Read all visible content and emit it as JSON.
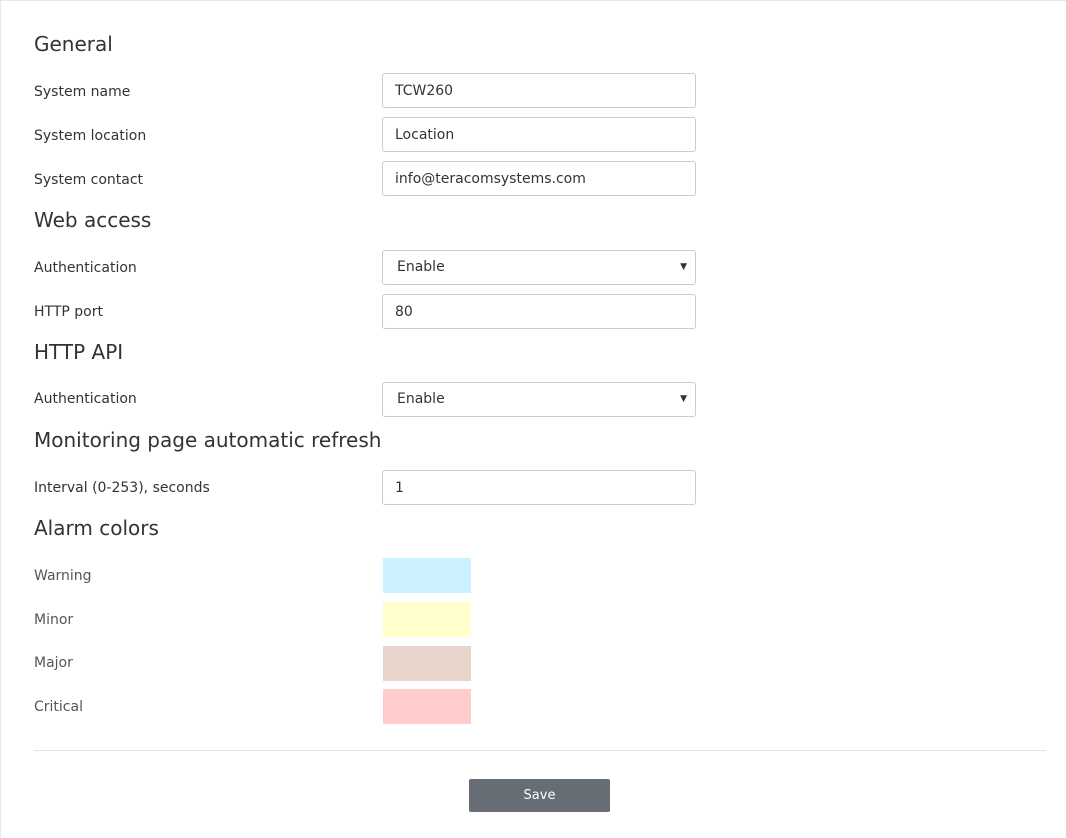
{
  "general": {
    "title": "General",
    "system_name": {
      "label": "System name",
      "value": "TCW260"
    },
    "system_location": {
      "label": "System location",
      "value": "Location"
    },
    "system_contact": {
      "label": "System contact",
      "value": "info@teracomsystems.com"
    }
  },
  "web_access": {
    "title": "Web access",
    "authentication": {
      "label": "Authentication",
      "value": "Enable"
    },
    "http_port": {
      "label": "HTTP port",
      "value": "80"
    }
  },
  "http_api": {
    "title": "HTTP API",
    "authentication": {
      "label": "Authentication",
      "value": "Enable"
    }
  },
  "monitoring": {
    "title": "Monitoring page automatic refresh",
    "interval": {
      "label": "Interval (0-253), seconds",
      "value": "1"
    }
  },
  "alarm_colors": {
    "title": "Alarm colors",
    "items": [
      {
        "label": "Warning",
        "color": "#ccf2ff"
      },
      {
        "label": "Minor",
        "color": "#ffffcc"
      },
      {
        "label": "Major",
        "color": "#e8d5cc"
      },
      {
        "label": "Critical",
        "color": "#ffcccc"
      }
    ]
  },
  "actions": {
    "save_label": "Save"
  }
}
